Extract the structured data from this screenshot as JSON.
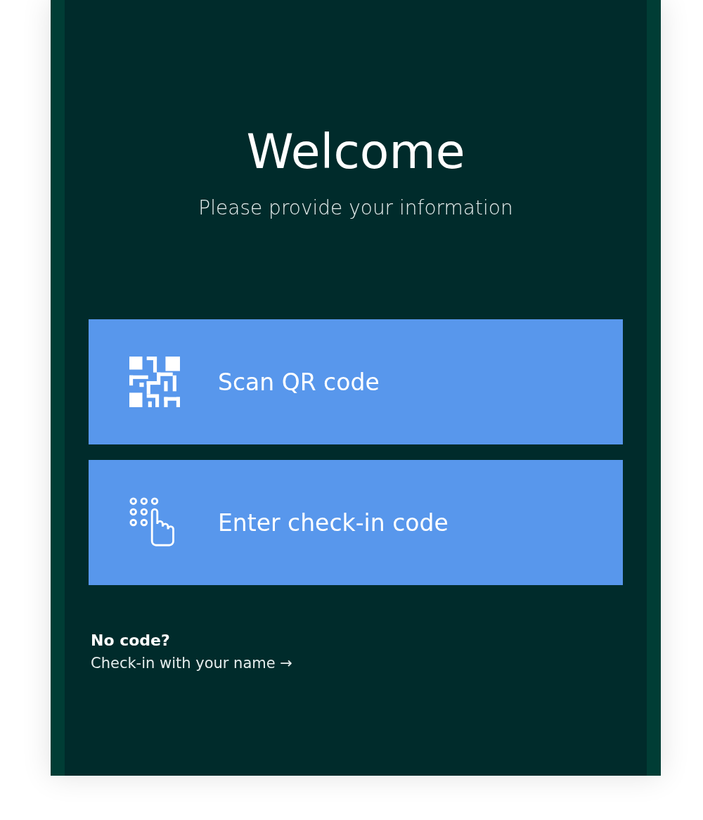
{
  "title": "Welcome",
  "subtitle": "Please provide your information",
  "options": [
    {
      "kind": "qr",
      "label": "Scan QR code"
    },
    {
      "kind": "keypad",
      "label": "Enter check-in code"
    }
  ],
  "fallback": {
    "heading": "No code?",
    "link": "Check-in with your name →"
  }
}
